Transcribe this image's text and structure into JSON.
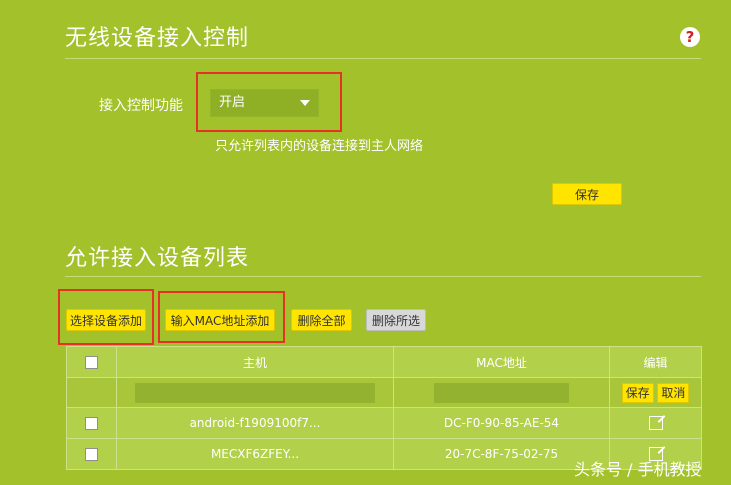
{
  "section1": {
    "title": "无线设备接入控制",
    "help_glyph": "?",
    "control_label": "接入控制功能",
    "control_value": "开启",
    "description": "只允许列表内的设备连接到主人网络",
    "save_label": "保存"
  },
  "section2": {
    "title": "允许接入设备列表",
    "buttons": {
      "select_add": "选择设备添加",
      "mac_add": "输入MAC地址添加",
      "delete_all": "删除全部",
      "delete_selected": "删除所选"
    },
    "table": {
      "headers": {
        "host": "主机",
        "mac": "MAC地址",
        "edit": "编辑"
      },
      "edit_row": {
        "save": "保存",
        "cancel": "取消"
      },
      "rows": [
        {
          "host": "android-f1909100f7...",
          "mac": "DC-F0-90-85-AE-54"
        },
        {
          "host": "MECXF6ZFEY...",
          "mac": "20-7C-8F-75-02-75"
        }
      ]
    }
  },
  "watermark": "头条号 / 手机教授",
  "colors": {
    "background": "#a2c12a",
    "button": "#ffe400",
    "highlight": "#e53226"
  }
}
